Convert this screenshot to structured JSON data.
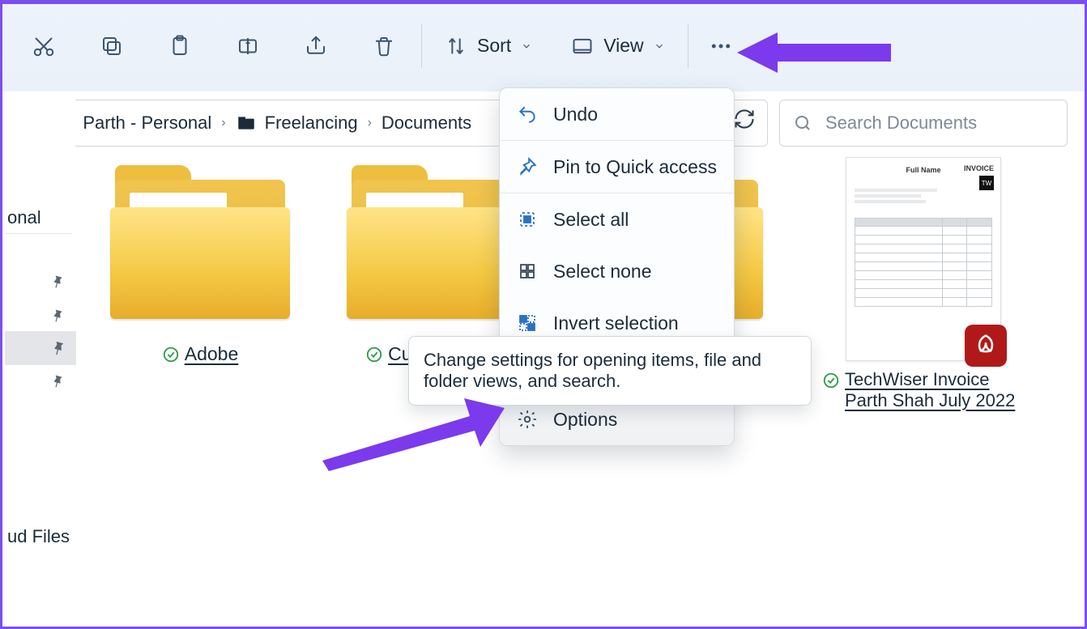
{
  "toolbar": {
    "sort_label": "Sort",
    "view_label": "View"
  },
  "breadcrumb": {
    "items": [
      "Parth - Personal",
      "Freelancing",
      "Documents"
    ]
  },
  "search": {
    "placeholder": "Search Documents"
  },
  "sidebar": {
    "label_truncated_top": "onal",
    "label_truncated_bottom": "ud Files"
  },
  "items": {
    "folder1_label": "Adobe",
    "folder2_label": "Custor",
    "file1_label": "TechWiser Invoice Parth Shah July 2022"
  },
  "doc_preview": {
    "header_left": "Full Name",
    "header_right": "INVOICE",
    "badge": "TW"
  },
  "context_menu": {
    "undo": "Undo",
    "pin": "Pin to Quick access",
    "select_all": "Select all",
    "select_none": "Select none",
    "invert_selection": "Invert selection",
    "options": "Options"
  },
  "tooltip": {
    "options": "Change settings for opening items, file and folder views, and search."
  }
}
